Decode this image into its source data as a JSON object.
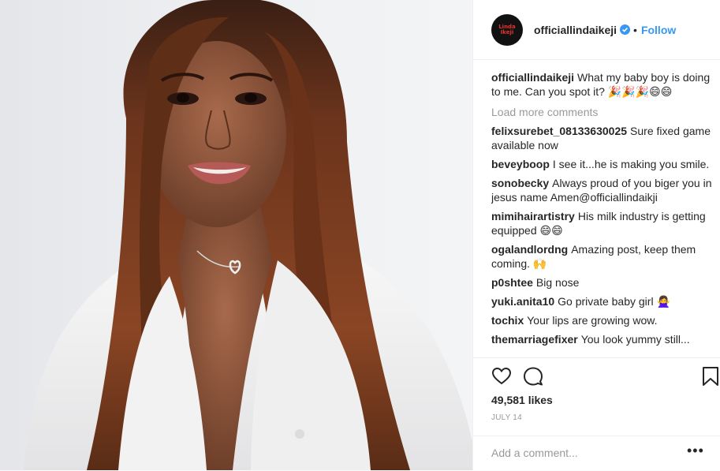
{
  "post": {
    "username": "officiallindaikeji",
    "follow_label": "Follow",
    "separator": "•",
    "avatar_text": "Linda Ikeji",
    "verified": true,
    "caption": {
      "user": "officiallindaikeji",
      "text": "What my baby boy is doing to me. Can you spot it? 🎉🎉🎉😄😄"
    },
    "load_more": "Load more comments",
    "comments": [
      {
        "user": "felixsurebet_08133630025",
        "text": "Sure fixed game available now"
      },
      {
        "user": "beveyboop",
        "text": "I see it...he is making you smile."
      },
      {
        "user": "sonobecky",
        "text": "Always proud of you biger you in jesus name Amen@officiallindaikji"
      },
      {
        "user": "mimihairartistry",
        "text": "His milk industry is getting equipped 😄😄"
      },
      {
        "user": "ogalandlordng",
        "text": "Amazing post, keep them coming. 🙌"
      },
      {
        "user": "p0shtee",
        "text": "Big nose"
      },
      {
        "user": "yuki.anita10",
        "text": "Go private baby girl 🙅‍♀️"
      },
      {
        "user": "tochix",
        "text": "Your lips are growing wow."
      },
      {
        "user": "themarriagefixer",
        "text": "You look yummy still..."
      }
    ],
    "likes": "49,581 likes",
    "date": "JULY 14",
    "add_comment_placeholder": "Add a comment...",
    "more_options": "•••"
  },
  "icons": {
    "like": "heart-icon",
    "comment": "comment-icon",
    "save": "bookmark-icon",
    "verified": "verified-badge-icon"
  },
  "colors": {
    "follow": "#3897f0",
    "verified": "#3897f0",
    "muted": "#999999",
    "text": "#262626"
  }
}
